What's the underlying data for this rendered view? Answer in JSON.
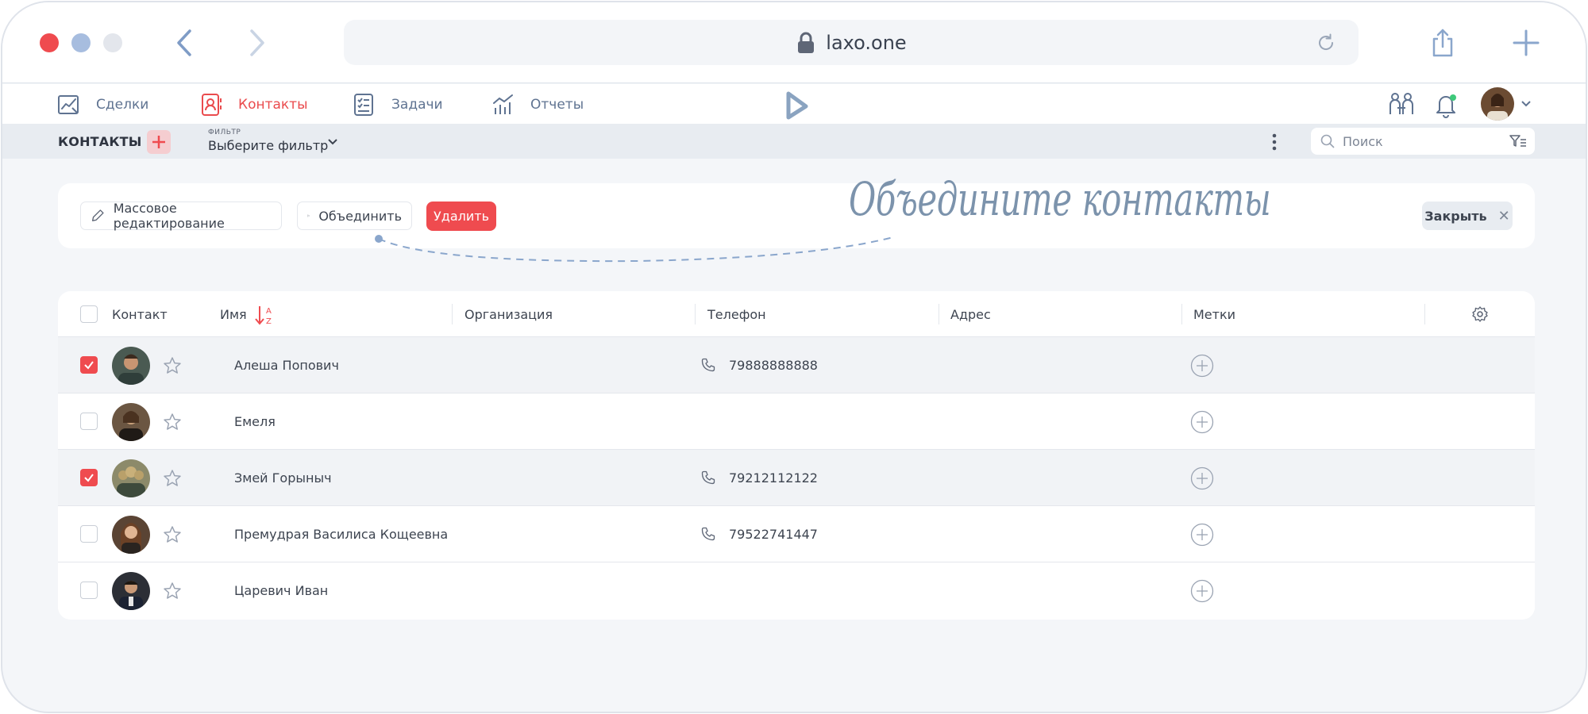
{
  "browser": {
    "url": "laxo.one"
  },
  "nav": {
    "items": [
      {
        "label": "Сделки",
        "icon": "deals-chart-icon",
        "active": false
      },
      {
        "label": "Контакты",
        "icon": "contacts-book-icon",
        "active": true
      },
      {
        "label": "Задачи",
        "icon": "tasks-checklist-icon",
        "active": false
      },
      {
        "label": "Отчеты",
        "icon": "reports-chart-icon",
        "active": false
      }
    ]
  },
  "toolbar": {
    "title": "КОНТАКТЫ",
    "filter_caption": "ФИЛЬТР",
    "filter_value": "Выберите фильтр",
    "search_placeholder": "Поиск"
  },
  "actions": {
    "mass_edit": "Массовое редактирование",
    "merge": "Объединить",
    "delete": "Удалить",
    "close": "Закрыть",
    "hint": "Объедините контакты"
  },
  "table": {
    "columns": {
      "contact": "Контакт",
      "name": "Имя",
      "organization": "Организация",
      "phone": "Телефон",
      "address": "Адрес",
      "tags": "Метки"
    },
    "rows": [
      {
        "name": "Алеша Попович",
        "phone": "79888888888",
        "selected": true
      },
      {
        "name": "Емеля",
        "phone": "",
        "selected": false
      },
      {
        "name": "Змей Горыныч",
        "phone": "79212112122",
        "selected": true
      },
      {
        "name": "Премудрая Василиса Кощеевна",
        "phone": "79522741447",
        "selected": false
      },
      {
        "name": "Царевич Иван",
        "phone": "",
        "selected": false
      }
    ]
  },
  "colors": {
    "accent": "#ef4b4f",
    "nav_icon": "#5f7391",
    "background": "#f4f6f9"
  }
}
